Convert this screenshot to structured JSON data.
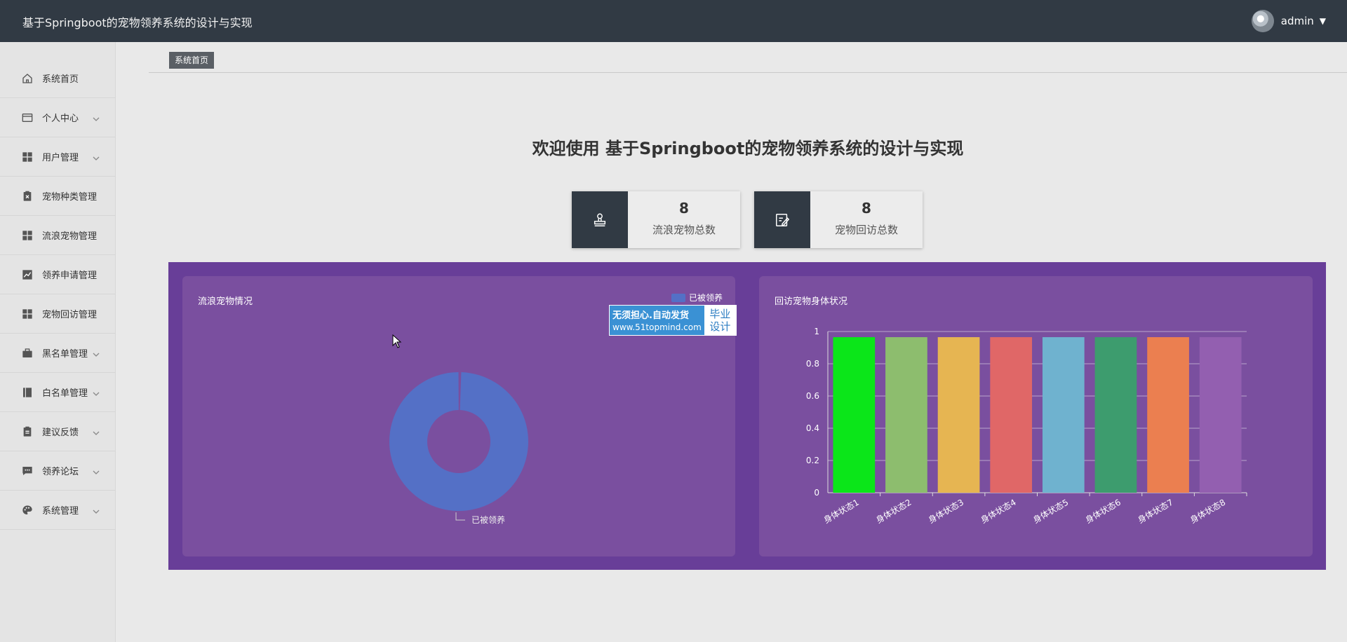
{
  "header": {
    "title": "基于Springboot的宠物领养系统的设计与实现",
    "user_name": "admin"
  },
  "sidebar": {
    "items": [
      {
        "label": "系统首页",
        "icon": "home-icon",
        "has_arrow": false
      },
      {
        "label": "个人中心",
        "icon": "id-card-icon",
        "has_arrow": true
      },
      {
        "label": "用户管理",
        "icon": "grid-icon",
        "has_arrow": true
      },
      {
        "label": "宠物种类管理",
        "icon": "clipboard-x-icon",
        "has_arrow": false
      },
      {
        "label": "流浪宠物管理",
        "icon": "grid-icon",
        "has_arrow": false
      },
      {
        "label": "领养申请管理",
        "icon": "line-chart-icon",
        "has_arrow": false
      },
      {
        "label": "宠物回访管理",
        "icon": "grid-icon",
        "has_arrow": false
      },
      {
        "label": "黑名单管理",
        "icon": "briefcase-icon",
        "has_arrow": true
      },
      {
        "label": "白名单管理",
        "icon": "book-icon",
        "has_arrow": true
      },
      {
        "label": "建议反馈",
        "icon": "clipboard-icon",
        "has_arrow": true
      },
      {
        "label": "领养论坛",
        "icon": "chat-icon",
        "has_arrow": true
      },
      {
        "label": "系统管理",
        "icon": "palette-icon",
        "has_arrow": true
      }
    ]
  },
  "breadcrumb": {
    "current": "系统首页"
  },
  "welcome": "欢迎使用 基于Springboot的宠物领养系统的设计与实现",
  "stats": [
    {
      "value": "8",
      "label": "流浪宠物总数",
      "icon": "stamp-icon"
    },
    {
      "value": "8",
      "label": "宠物回访总数",
      "icon": "edit-note-icon"
    }
  ],
  "watermark": {
    "line1": "无须担心.自动发货",
    "line2": "www.51topmind.com",
    "right1": "毕业",
    "right2": "设计"
  },
  "chart_data": [
    {
      "type": "pie",
      "title": "流浪宠物情况",
      "legend": [
        "已被领养"
      ],
      "legend_position": "top-right",
      "slices": [
        {
          "name": "已被领养",
          "value": 8
        }
      ],
      "colors": [
        "#5470c6"
      ],
      "donut": true
    },
    {
      "type": "bar",
      "title": "回访宠物身体状况",
      "categories": [
        "身体状态1",
        "身体状态2",
        "身体状态3",
        "身体状态4",
        "身体状态5",
        "身体状态6",
        "身体状态7",
        "身体状态8"
      ],
      "values": [
        1,
        1,
        1,
        1,
        1,
        1,
        1,
        1
      ],
      "ylim": [
        0,
        1
      ],
      "yticks": [
        "0",
        "0.2",
        "0.4",
        "0.6",
        "0.8",
        "1"
      ],
      "grid": true,
      "colors": [
        "#0be619",
        "#8dbd6e",
        "#e6b552",
        "#e06767",
        "#6fb2cf",
        "#3d9c6e",
        "#eb7f50",
        "#935fb0"
      ]
    }
  ]
}
